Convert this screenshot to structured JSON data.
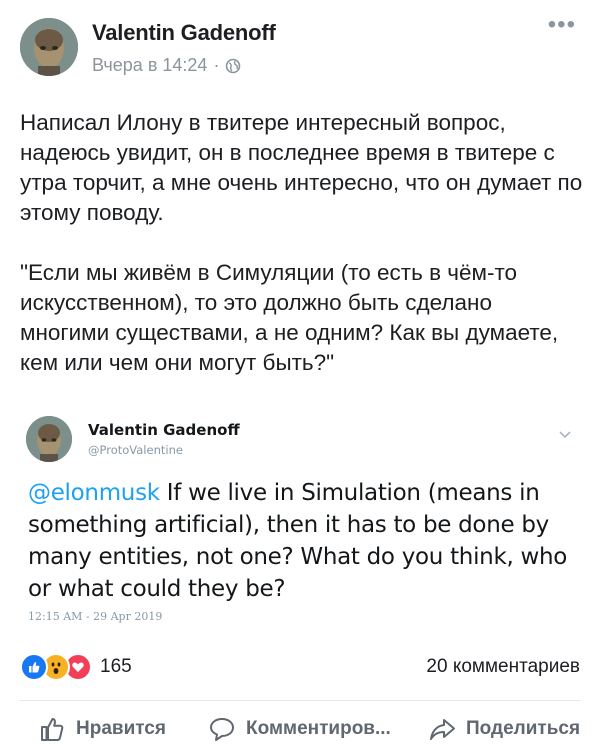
{
  "post": {
    "author": "Valentin Gadenoff",
    "time": "Вчера в 14:24",
    "separator": "·",
    "privacy_icon": "globe-icon",
    "more_label": "•••",
    "text_paragraph_1": "Написал Илону в твитере интересный вопрос, надеюсь увидит, он в последнее время в твитере с утра торчит, а мне очень интересно, что он думает по этому поводу.",
    "text_paragraph_2": "\"Если мы живём в Симуляции (то есть в чём-то искусственном), то это должно быть сделано многими существами, а не одним? Как вы думаете, кем или чем они могут быть?\""
  },
  "tweet": {
    "name": "Valentin Gadenoff",
    "handle": "@ProtoValentine",
    "mention": "@elonmusk",
    "text": " If we live in Simulation (means in something artificial), then it has to be done by many entities, not one? What do you think, who or what could they be?",
    "timestamp": "12:15 AM - 29 Apr 2019"
  },
  "engagement": {
    "reaction_icons": [
      "like-icon",
      "wow-icon",
      "love-icon"
    ],
    "reaction_count": "165",
    "comments": "20 комментариев"
  },
  "actions": {
    "like": "Нравится",
    "comment": "Комментиров...",
    "share": "Поделиться"
  },
  "colors": {
    "text": "#1c1e21",
    "muted": "#8d949e",
    "mention": "#1da1f2",
    "like_blue": "#1877f2",
    "love_red": "#f33e58",
    "wow_yellow": "#f7b125"
  }
}
